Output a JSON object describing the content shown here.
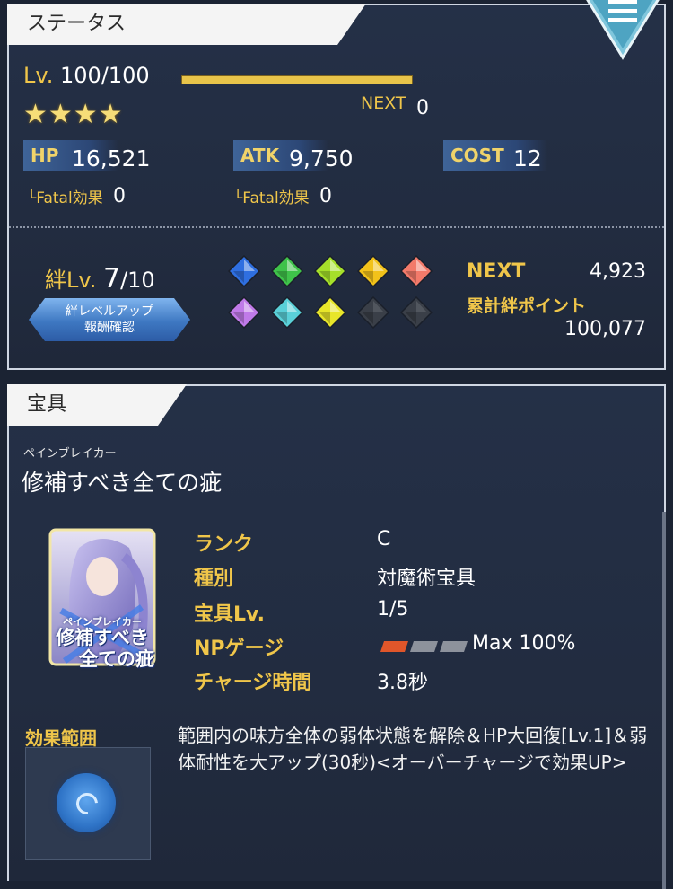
{
  "status": {
    "title": "ステータス",
    "level_label": "Lv.",
    "level_value": "100/100",
    "next_label": "NEXT",
    "next_value": "0",
    "stars": "★★★★",
    "hp_label": "HP",
    "hp_value": "16,521",
    "atk_label": "ATK",
    "atk_value": "9,750",
    "cost_label": "COST",
    "cost_value": "12",
    "fatal_label": "└Fatal効果",
    "fatal_hp_value": "0",
    "fatal_atk_value": "0",
    "bond_label": "絆Lv.",
    "bond_level": "7",
    "bond_max": "/10",
    "bond_button_line1": "絆レベルアップ",
    "bond_button_line2": "報酬確認",
    "bond_next_label": "NEXT",
    "bond_next_value": "4,923",
    "bond_total_label": "累計絆ポイント",
    "bond_total_value": "100,077",
    "gems": [
      {
        "color": "#2f6fe0",
        "lit": true
      },
      {
        "color": "#3fc24a",
        "lit": true
      },
      {
        "color": "#a6e02a",
        "lit": true
      },
      {
        "color": "#f2c21a",
        "lit": true
      },
      {
        "color": "#f27a6a",
        "lit": true
      },
      {
        "color": "#c07ae8",
        "lit": true
      },
      {
        "color": "#5ad0d8",
        "lit": true
      },
      {
        "color": "#e8e62a",
        "lit": true
      },
      {
        "color": "#3a3f48",
        "lit": false
      },
      {
        "color": "#3a3f48",
        "lit": false
      }
    ]
  },
  "noble_phantasm": {
    "title": "宝具",
    "ruby": "ペインブレイカー",
    "name": "修補すべき全ての疵",
    "card_ruby": "ペインブレイカー",
    "card_line1": "修補すべき",
    "card_line2": "全ての疵",
    "rank_label": "ランク",
    "rank_value": "C",
    "type_label": "種別",
    "type_value": "対魔術宝具",
    "np_level_label": "宝具Lv.",
    "np_level_value": "1/5",
    "gauge_label": "NPゲージ",
    "gauge_value": "Max 100%",
    "gauge_fill_segments": 1,
    "gauge_segments": 3,
    "charge_label": "チャージ時間",
    "charge_value": "3.8秒",
    "range_label": "効果範囲",
    "effect_text": "範囲内の味方全体の弱体状態を解除＆HP大回復[Lv.1]＆弱体耐性を大アップ(30秒)<オーバーチャージで効果UP>"
  },
  "colors": {
    "gold": "#f0c64a",
    "panel": "#222c40",
    "background": "#1b2333"
  }
}
